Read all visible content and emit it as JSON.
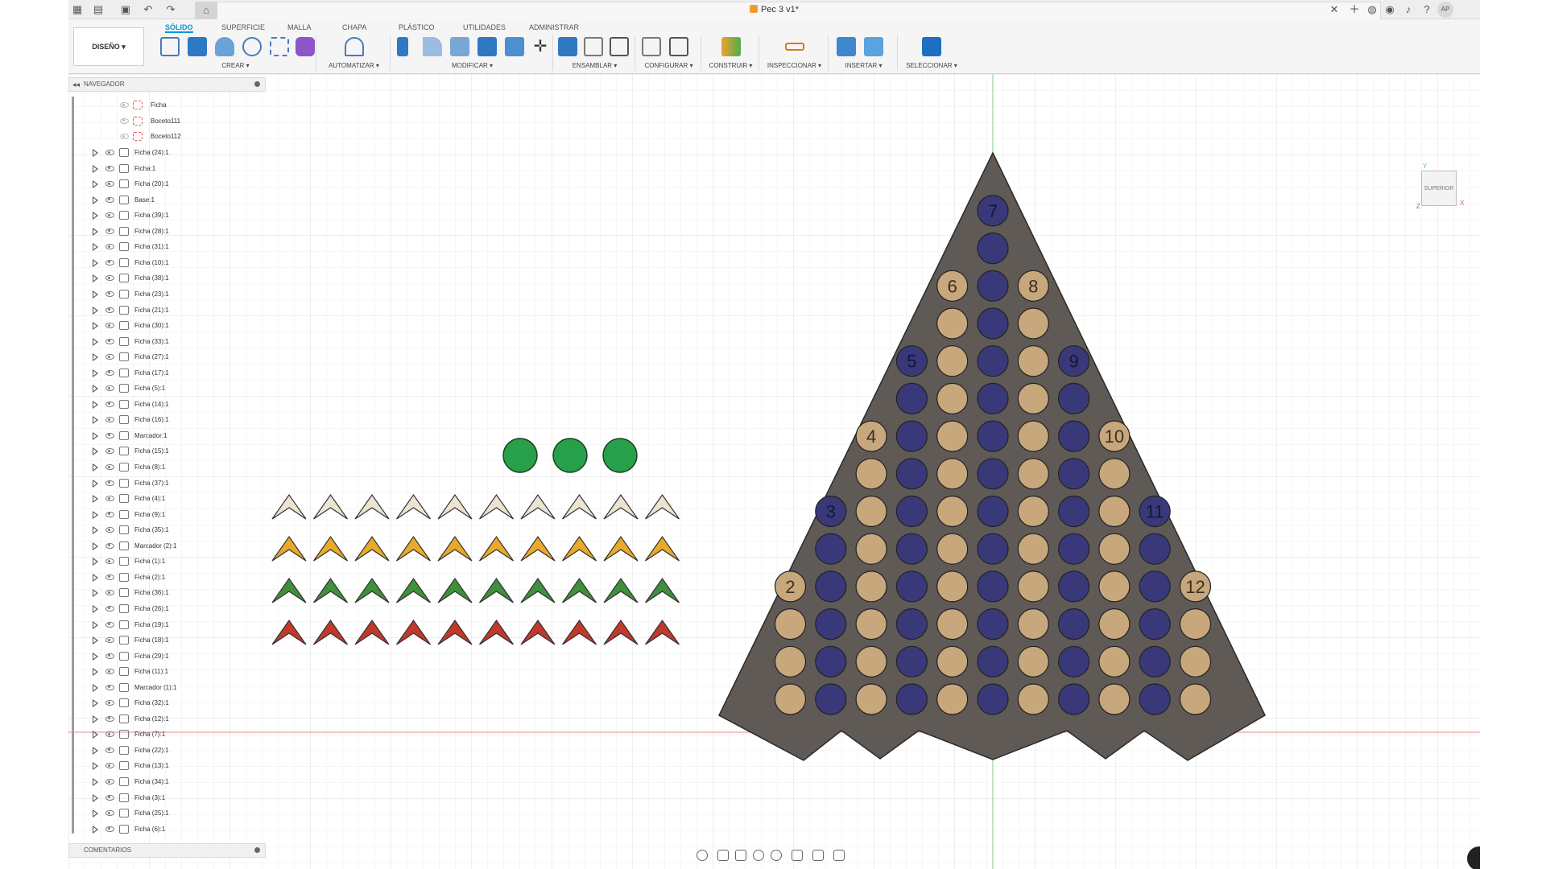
{
  "app": {
    "document_title": "Pec 3 v1*",
    "user_initials": "AP"
  },
  "ribbon": {
    "workspace_button": "DISEÑO ▾",
    "tabs": [
      "SÓLIDO",
      "SUPERFICIE",
      "MALLA",
      "CHAPA",
      "PLÁSTICO",
      "UTILIDADES",
      "ADMINISTRAR"
    ],
    "active_tab": "SÓLIDO",
    "groups": [
      {
        "label": "CREAR ▾"
      },
      {
        "label": "AUTOMATIZAR ▾"
      },
      {
        "label": "MODIFICAR ▾"
      },
      {
        "label": "ENSAMBLAR ▾"
      },
      {
        "label": "CONFIGURAR ▾"
      },
      {
        "label": "CONSTRUIR ▾"
      },
      {
        "label": "INSPECCIONAR ▾"
      },
      {
        "label": "INSERTAR ▾"
      },
      {
        "label": "SELECCIONAR ▾"
      }
    ]
  },
  "browser": {
    "title": "NAVEGADOR",
    "sketch_items": [
      "Ficha",
      "Boceto111",
      "Boceto112"
    ],
    "components": [
      "Ficha (24):1",
      "Ficha:1",
      "Ficha (20):1",
      "Base:1",
      "Ficha (39):1",
      "Ficha (28):1",
      "Ficha (31):1",
      "Ficha (10):1",
      "Ficha (38):1",
      "Ficha (23):1",
      "Ficha (21):1",
      "Ficha (30):1",
      "Ficha (33):1",
      "Ficha (27):1",
      "Ficha (17):1",
      "Ficha (5):1",
      "Ficha (14):1",
      "Ficha (16):1",
      "Marcador:1",
      "Ficha (15):1",
      "Ficha (8):1",
      "Ficha (37):1",
      "Ficha (4):1",
      "Ficha (9):1",
      "Ficha (35):1",
      "Marcador (2):1",
      "Ficha (1):1",
      "Ficha (2):1",
      "Ficha (36):1",
      "Ficha (26):1",
      "Ficha (19):1",
      "Ficha (18):1",
      "Ficha (29):1",
      "Ficha (11):1",
      "Marcador (1):1",
      "Ficha (32):1",
      "Ficha (12):1",
      "Ficha (7):1",
      "Ficha (22):1",
      "Ficha (13):1",
      "Ficha (34):1",
      "Ficha (3):1",
      "Ficha (25):1",
      "Ficha (6):1"
    ]
  },
  "comments": {
    "title": "COMENTARIOS"
  },
  "viewcube": {
    "face": "SUPERIOR",
    "axis_x": "X",
    "axis_y": "Y",
    "axis_z": "Z"
  },
  "board": {
    "colors": {
      "board": "#5f5a55",
      "tan": "#c8a77d",
      "navy": "#39397a",
      "green": "#26a04a",
      "cream": "#ece3d2",
      "orange": "#e9a92b",
      "dkgreen": "#3f8f3c",
      "red": "#c0392b"
    },
    "column_labels": [
      "2",
      "3",
      "4",
      "5",
      "6",
      "7",
      "8",
      "9",
      "10",
      "11",
      "12"
    ],
    "column_slots": [
      3,
      5,
      7,
      9,
      11,
      13,
      11,
      9,
      7,
      5,
      3
    ],
    "markers": 3,
    "chevron_rows": [
      "cream",
      "orange",
      "dkgreen",
      "red"
    ],
    "chevrons_per_row": 10
  }
}
